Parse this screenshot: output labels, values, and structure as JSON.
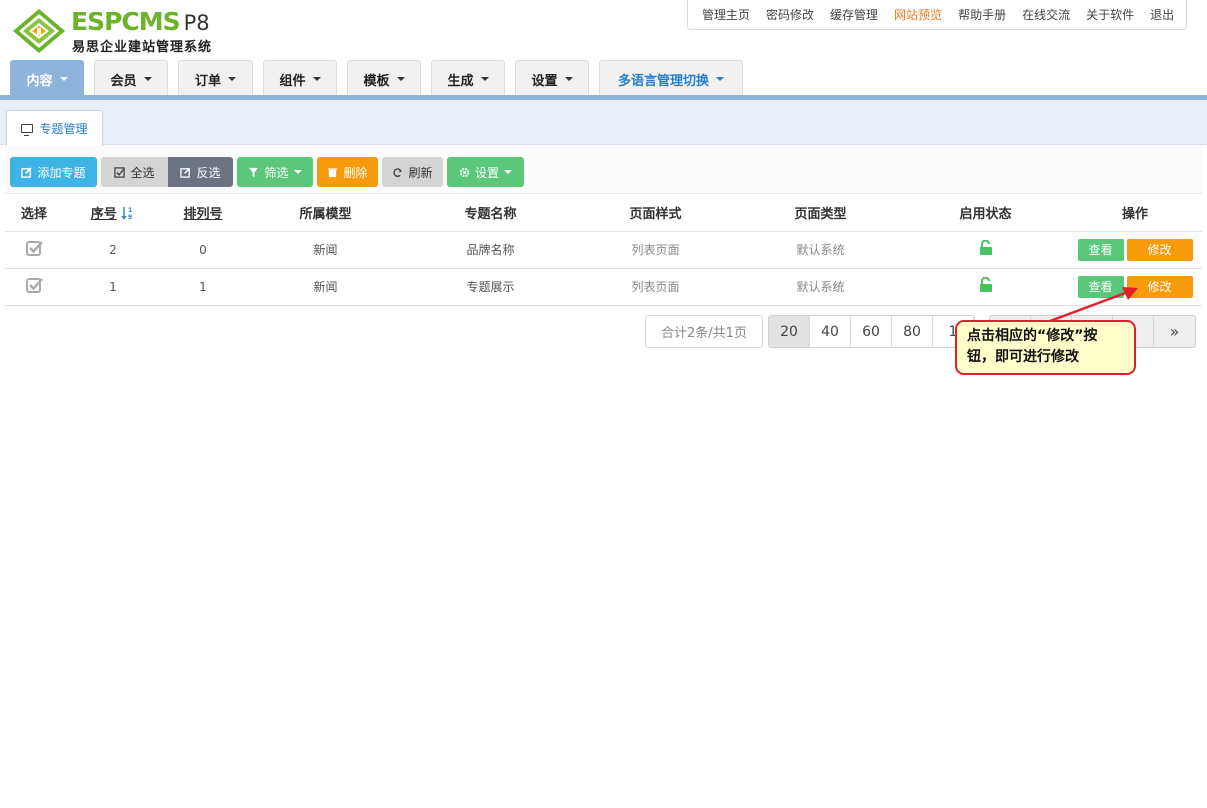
{
  "brand": {
    "name": "ESPCMS",
    "version": "P8",
    "subtitle": "易思企业建站管理系统",
    "colors": {
      "green": "#6bb32a",
      "orange": "#f79b0c",
      "blue": "#2a7fc8"
    }
  },
  "top_links": [
    "管理主页",
    "密码修改",
    "缓存管理",
    "网站预览",
    "帮助手册",
    "在线交流",
    "关于软件",
    "退出"
  ],
  "top_links_active": "网站预览",
  "nav_tabs": [
    "内容",
    "会员",
    "订单",
    "组件",
    "模板",
    "生成",
    "设置",
    "多语言管理切换"
  ],
  "sub_tab": "专题管理",
  "toolbar": {
    "add": "添加专题",
    "select_all": "全选",
    "invert": "反选",
    "filter": "筛选",
    "delete": "删除",
    "refresh": "刷新",
    "settings": "设置"
  },
  "table": {
    "headers": [
      "选择",
      "序号",
      "排列号",
      "所属模型",
      "专题名称",
      "页面样式",
      "页面类型",
      "启用状态",
      "操作"
    ],
    "rows": [
      {
        "id": "2",
        "order": "0",
        "model": "新闻",
        "name": "品牌名称",
        "style": "列表页面",
        "type": "默认系统",
        "status": "unlocked-icon"
      },
      {
        "id": "1",
        "order": "1",
        "model": "新闻",
        "name": "专题展示",
        "style": "列表页面",
        "type": "默认系统",
        "status": "unlocked-icon"
      }
    ],
    "view_label": "查看",
    "edit_label": "修改"
  },
  "pagination": {
    "total": "合计2条/共1页",
    "page_sizes": [
      "20",
      "40",
      "60",
      "80",
      "1"
    ],
    "selected_size": "20",
    "last": "»"
  },
  "callout": {
    "text_line1": "点击相应的“修改”按",
    "text_line2": "钮，即可进行修改"
  }
}
